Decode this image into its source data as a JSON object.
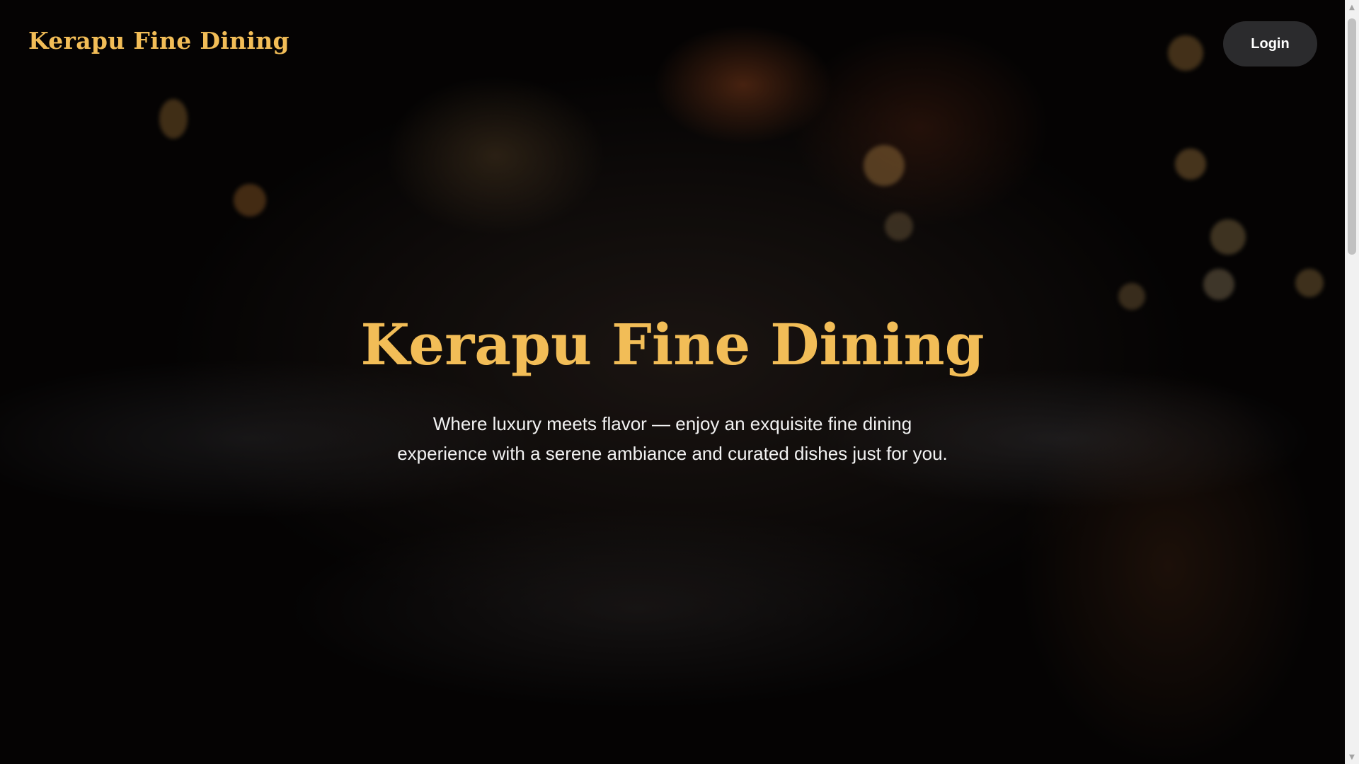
{
  "header": {
    "brand": "Kerapu Fine Dining",
    "login_label": "Login"
  },
  "hero": {
    "title": "Kerapu Fine Dining",
    "subtitle_line1": "Where luxury meets flavor — enjoy an exquisite fine dining",
    "subtitle_line2": "experience with a serene ambiance and curated dishes just for you."
  },
  "colors": {
    "accent_gold": "#f2bd57",
    "button_bg": "#2b2b2d",
    "text_light": "#f2f2f2"
  },
  "icons": {
    "scroll_up": "triangle-up-icon",
    "scroll_down": "triangle-down-icon"
  }
}
